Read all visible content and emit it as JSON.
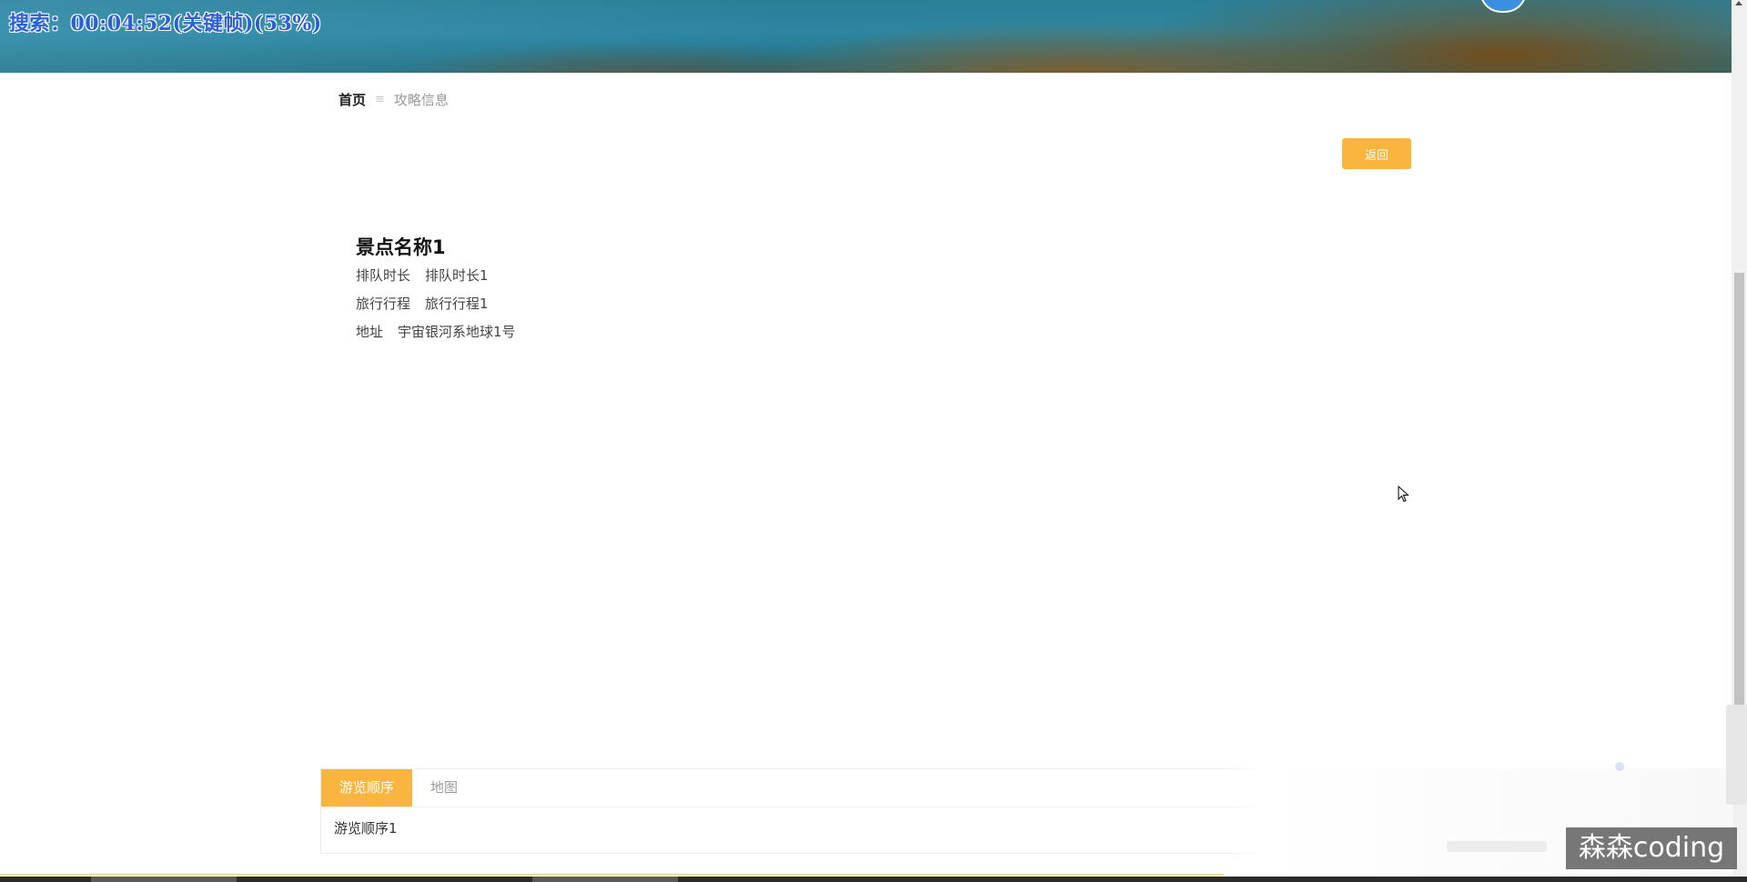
{
  "banner": {
    "overlay_text": "搜索：00:04:52(关键帧)(53%)"
  },
  "breadcrumb": {
    "home": "首页",
    "separator": "≡",
    "current": "攻略信息"
  },
  "actions": {
    "back_label": "返回"
  },
  "detail": {
    "title": "景点名称1",
    "fields": [
      {
        "label": "排队时长",
        "value": "排队时长1"
      },
      {
        "label": "旅行行程",
        "value": "旅行行程1"
      },
      {
        "label": "地址",
        "value": "宇宙银河系地球1号"
      }
    ]
  },
  "tabs": {
    "items": [
      {
        "label": "游览顺序",
        "active": true
      },
      {
        "label": "地图",
        "active": false
      }
    ],
    "content": "游览顺序1"
  },
  "watermark": {
    "text": "森森coding"
  },
  "colors": {
    "accent": "#f9b53d",
    "overlay_text": "#2d5fd6",
    "avatar": "#3a8fe0"
  },
  "icons": {
    "cursor": "mouse-cursor-icon",
    "scroll_up": "scroll-up-arrow-icon"
  }
}
